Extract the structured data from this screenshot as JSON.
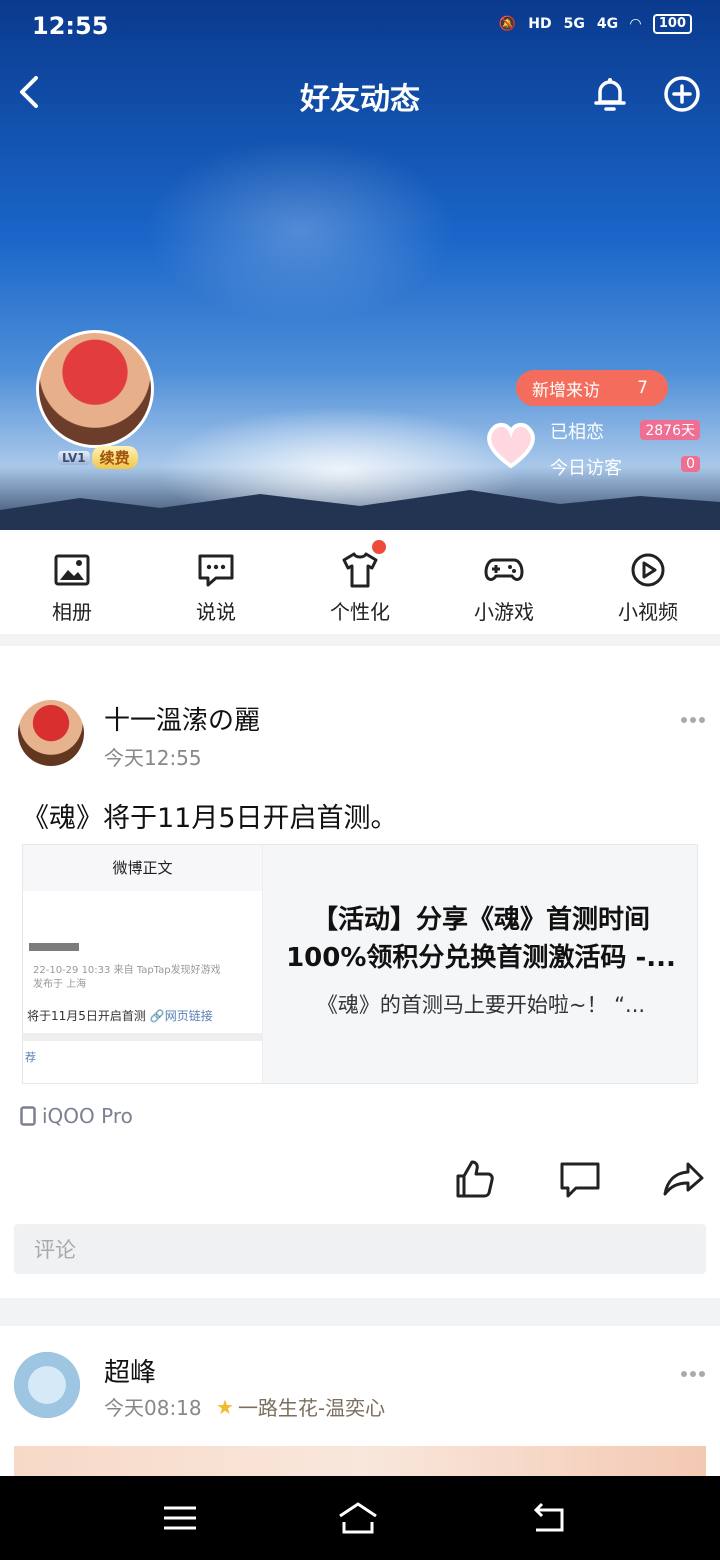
{
  "status_bar": {
    "time": "12:55",
    "hd_label": "HD",
    "net_5g": "5G",
    "net_4g": "4G",
    "battery": "100"
  },
  "nav": {
    "title": "好友动态"
  },
  "profile": {
    "level": "LV1",
    "renew_label": "续费",
    "new_visitors_label": "新增来访",
    "new_visitors_count": "7",
    "together_label": "已相恋",
    "together_days": "2876天",
    "today_visitors_label": "今日访客",
    "today_visitors_count": "0"
  },
  "quick_menu": [
    {
      "label": "相册",
      "icon": "photo-album-icon"
    },
    {
      "label": "说说",
      "icon": "chat-bubble-icon"
    },
    {
      "label": "个性化",
      "icon": "tshirt-icon"
    },
    {
      "label": "小游戏",
      "icon": "gamepad-icon"
    },
    {
      "label": "小视频",
      "icon": "play-circle-icon"
    }
  ],
  "posts": [
    {
      "user": "十一溫溹の麗",
      "time": "今天12:55",
      "text": "《魂》将于11月5日开启首测。",
      "share": {
        "thumb_header": "微博正文",
        "thumb_meta1": "22-10-29 10:33  来自 TapTap发现好游戏",
        "thumb_meta2": "发布于 上海",
        "thumb_text": "将于11月5日开启首测",
        "thumb_link": "网页链接",
        "thumb_tag": "荐",
        "title": "【活动】分享《魂》首测时间100%领积分兑换首测激活码 -...",
        "desc": "《魂》的首测马上要开始啦~！ “..."
      },
      "device": "iQOO Pro",
      "comment_placeholder": "评论"
    },
    {
      "user": "超峰",
      "time": "今天08:18",
      "tag": "一路生花-温奕心"
    }
  ],
  "colors": {
    "accent_red": "#ef4b3c",
    "visitor_pill": "#f46d5c",
    "badge_pink": "#ef6f93"
  }
}
